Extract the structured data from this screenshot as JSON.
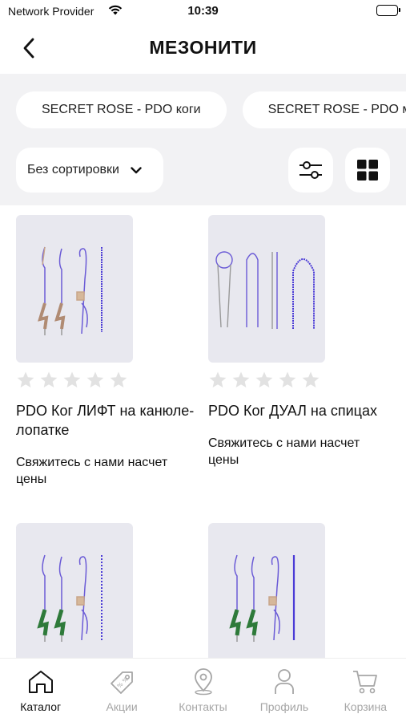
{
  "status_bar": {
    "carrier": "Network Provider",
    "time": "10:39",
    "battery_level": 1.0
  },
  "header": {
    "title": "МЕЗОНИТИ",
    "back_icon": "chevron-left-icon"
  },
  "filters": {
    "chips": [
      {
        "label": "SECRET ROSE - PDO коги"
      },
      {
        "label": "SECRET ROSE - PDO м"
      }
    ],
    "sort_label": "Без сортировки",
    "sort_icon": "chevron-down-icon",
    "filter_icon": "sliders-icon",
    "grid_icon": "grid-view-icon"
  },
  "products": [
    {
      "name": "PDO Ког ЛИФТ на канюле-лопатке",
      "price_text": "Свяжитесь с нами насчет цены",
      "rating": 0,
      "image_icon": "thread-cog-lift-image"
    },
    {
      "name": "PDO Ког ДУАЛ на спицах",
      "price_text": "Свяжитесь с нами насчет цены",
      "rating": 0,
      "image_icon": "thread-dual-image"
    },
    {
      "name": "",
      "price_text": "",
      "rating": 0,
      "image_icon": "thread-green-cannula-image"
    },
    {
      "name": "",
      "price_text": "",
      "rating": 0,
      "image_icon": "thread-green-cannula-image"
    }
  ],
  "tabs": [
    {
      "label": "Каталог",
      "icon": "home-icon",
      "active": true
    },
    {
      "label": "Акции",
      "icon": "tag-icon",
      "active": false
    },
    {
      "label": "Контакты",
      "icon": "location-pin-icon",
      "active": false
    },
    {
      "label": "Профиль",
      "icon": "person-icon",
      "active": false
    },
    {
      "label": "Корзина",
      "icon": "cart-icon",
      "active": false
    }
  ],
  "colors": {
    "accent": "#111111",
    "inactive_tab": "#a6a6a6",
    "filter_bg": "#f2f2f4",
    "card_image_bg": "#e8e8ef",
    "star": "#e2e2e2"
  }
}
